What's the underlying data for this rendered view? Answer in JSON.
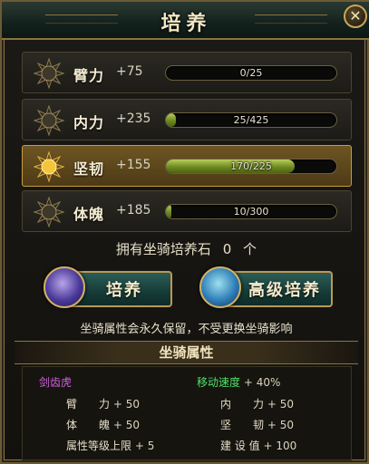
{
  "window": {
    "title": "培养",
    "close_label": "✕"
  },
  "stats": [
    {
      "name": "臂力",
      "bonus": "+75",
      "progress_text": "0/25",
      "fraction": 0.0,
      "active": false
    },
    {
      "name": "内力",
      "bonus": "+235",
      "progress_text": "25/425",
      "fraction": 0.0588,
      "active": false
    },
    {
      "name": "坚韧",
      "bonus": "+155",
      "progress_text": "170/225",
      "fraction": 0.7556,
      "active": true
    },
    {
      "name": "体魄",
      "bonus": "+185",
      "progress_text": "10/300",
      "fraction": 0.0333,
      "active": false
    }
  ],
  "stones": {
    "label": "拥有坐骑培养石",
    "count": "0",
    "unit": "个"
  },
  "buttons": {
    "train": "培养",
    "advanced": "高级培养"
  },
  "note": "坐骑属性会永久保留，不受更换坐骑影响",
  "attributes": {
    "header": "坐骑属性",
    "mount_name": "剑齿虎",
    "speed_label": "移动速度",
    "speed_value": "+ 40%",
    "rows": [
      {
        "l_label": "臂　　力",
        "l_value": "+ 50",
        "r_label": "内　　力",
        "r_value": "+ 50"
      },
      {
        "l_label": "体　　魄",
        "l_value": "+ 50",
        "r_label": "坚　　韧",
        "r_value": "+ 50"
      },
      {
        "l_label": "属性等级上限",
        "l_value": "+ 5",
        "r_label": "建 设 值",
        "r_value": "+ 100"
      }
    ]
  },
  "colors": {
    "accent_gold": "#c79c3e",
    "bar_green": "#6f8a22",
    "mount_name": "#d062e0",
    "speed": "#4fe06a"
  }
}
